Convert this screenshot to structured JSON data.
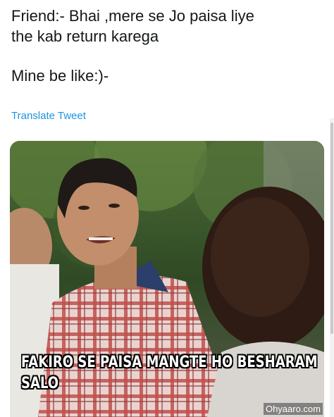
{
  "tweet": {
    "line1": "Friend:- Bhai ,mere se Jo paisa liye",
    "line2": "the kab return karega",
    "line3": "Mine be like:)-",
    "translate_label": "Translate Tweet"
  },
  "media": {
    "caption_line1": "FAKIRO SE PAISA MANGTE HO BESHARAM",
    "caption_line2": "SALO",
    "watermark": "Ohyaaro.com"
  },
  "colors": {
    "text": "#14171a",
    "link": "#1b95e0",
    "caption_text": "#ffffff",
    "caption_outline": "#000000"
  },
  "icons": []
}
